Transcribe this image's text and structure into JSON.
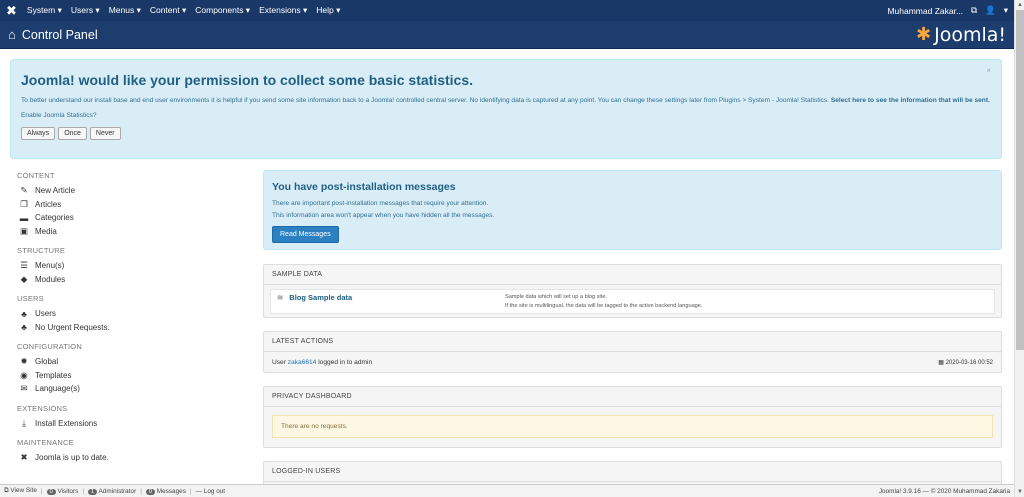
{
  "topnav": {
    "menu": [
      "System ▾",
      "Users ▾",
      "Menus ▾",
      "Content ▾",
      "Components ▾",
      "Extensions ▾",
      "Help ▾"
    ],
    "user": "Muhammad Zakar...",
    "user_caret": "▾"
  },
  "header": {
    "title": "Control Panel",
    "logo_text": "Joomla!"
  },
  "stats": {
    "title": "Joomla! would like your permission to collect some basic statistics.",
    "text": "To better understand our install base and end user environments it is helpful if you send some site information back to a Joomla! controlled central server. No identifying data is captured at any point. You can change these settings later from Plugins > System - Joomla! Statistics.",
    "link": "Select here to see the information that will be sent.",
    "ask": "Enable Joomla Statistics?",
    "buttons": [
      "Always",
      "Once",
      "Never"
    ],
    "close": "×"
  },
  "sidebar": {
    "content": {
      "label": "CONTENT",
      "items": [
        "New Article",
        "Articles",
        "Categories",
        "Media"
      ]
    },
    "structure": {
      "label": "STRUCTURE",
      "items": [
        "Menu(s)",
        "Modules"
      ]
    },
    "users": {
      "label": "USERS",
      "items": [
        "Users",
        "No Urgent Requests."
      ]
    },
    "configuration": {
      "label": "CONFIGURATION",
      "items": [
        "Global",
        "Templates",
        "Language(s)"
      ]
    },
    "extensions": {
      "label": "EXTENSIONS",
      "items": [
        "Install Extensions"
      ]
    },
    "maintenance": {
      "label": "MAINTENANCE",
      "items": [
        "Joomla is up to date."
      ]
    }
  },
  "post": {
    "title": "You have post-installation messages",
    "line1": "There are important post-installation messages that require your attention.",
    "line2": "This information area won't appear when you have hidden all the messages.",
    "button": "Read Messages"
  },
  "sample": {
    "header": "SAMPLE DATA",
    "name": "Blog Sample data",
    "desc1": "Sample data which will set up a blog site.",
    "desc2": "If the site is multilingual, the data will be tagged to the active backend language."
  },
  "latest": {
    "header": "LATEST ACTIONS",
    "prefix": "User",
    "user": "zaka6614",
    "suffix": "logged in to admin",
    "date": "2020-03-16 00:52"
  },
  "privacy": {
    "header": "PRIVACY DASHBOARD",
    "message": "There are no requests."
  },
  "logged": {
    "header": "LOGGED-IN USERS"
  },
  "footer": {
    "view_site": "View Site",
    "visitors_count": "0",
    "visitors": "Visitors",
    "admin_count": "1",
    "admin": "Administrator",
    "messages_count": "0",
    "messages": "Messages",
    "logout": "Log out",
    "version": "Joomla! 3.9.16 — © 2020 Muhammad Zakaria"
  }
}
